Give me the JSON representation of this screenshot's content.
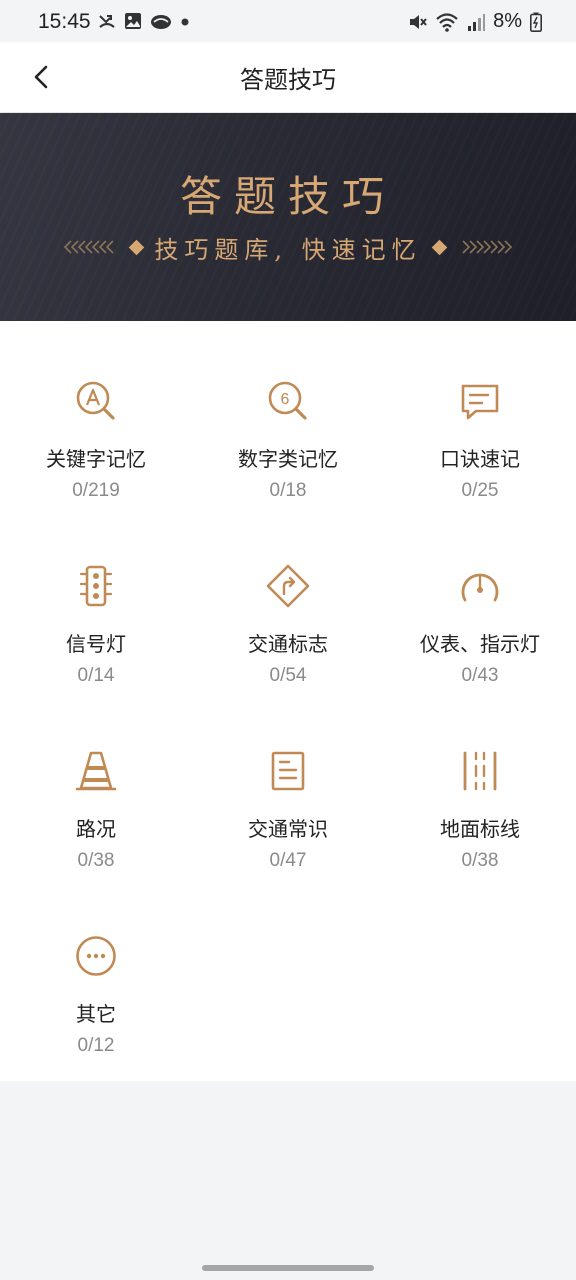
{
  "status_bar": {
    "time": "15:45",
    "battery": "8%",
    "icons": [
      "missed-call-icon",
      "gallery-icon",
      "cloud-icon",
      "dot-icon",
      "mute-icon",
      "wifi-icon",
      "signal-icon",
      "battery-icon"
    ]
  },
  "nav": {
    "title": "答题技巧",
    "back_icon": "chevron-left-icon"
  },
  "banner": {
    "title": "答题技巧",
    "subtitle": "技巧题库, 快速记忆"
  },
  "colors": {
    "accent": "#d7a874",
    "icon": "#c08a55",
    "banner_bg": "#2a2b35"
  },
  "categories": [
    {
      "label": "关键字记忆",
      "count": "0/219",
      "icon": "magnifier-letter-a-icon"
    },
    {
      "label": "数字类记忆",
      "count": "0/18",
      "icon": "magnifier-number-6-icon"
    },
    {
      "label": "口诀速记",
      "count": "0/25",
      "icon": "chat-bubble-icon"
    },
    {
      "label": "信号灯",
      "count": "0/14",
      "icon": "traffic-light-icon"
    },
    {
      "label": "交通标志",
      "count": "0/54",
      "icon": "traffic-sign-icon"
    },
    {
      "label": "仪表、指示灯",
      "count": "0/43",
      "icon": "gauge-icon"
    },
    {
      "label": "路况",
      "count": "0/38",
      "icon": "traffic-cone-icon"
    },
    {
      "label": "交通常识",
      "count": "0/47",
      "icon": "document-icon"
    },
    {
      "label": "地面标线",
      "count": "0/38",
      "icon": "road-lines-icon"
    },
    {
      "label": "其它",
      "count": "0/12",
      "icon": "more-circle-icon"
    }
  ]
}
